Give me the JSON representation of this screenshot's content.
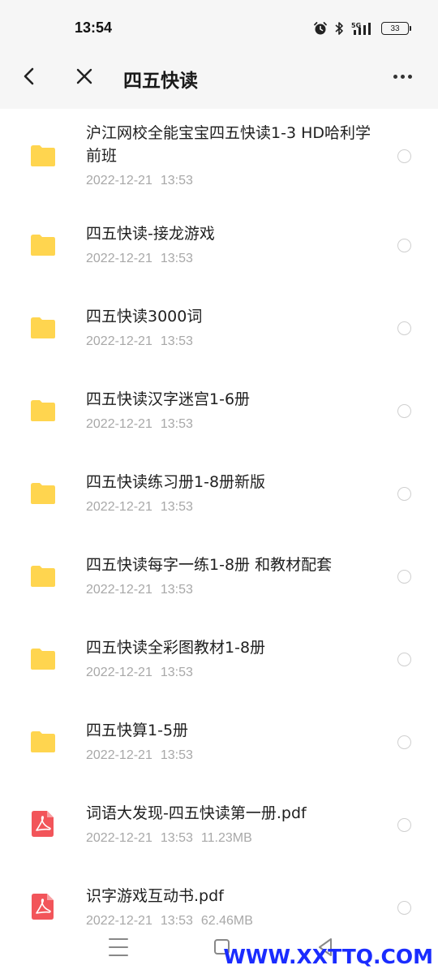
{
  "status_bar": {
    "time": "13:54",
    "icons": [
      "alarm-icon",
      "bluetooth-icon",
      "signal-5g-icon",
      "battery-icon"
    ],
    "network": "5G",
    "battery": "33"
  },
  "header": {
    "title": "四五快读",
    "back_icon": "chevron-left-icon",
    "close_icon": "close-icon",
    "more_icon": "more-icon"
  },
  "files": [
    {
      "name": "沪江网校全能宝宝四五快读1-3 HD哈利学前班",
      "date": "2022-12-21",
      "time": "13:53",
      "size": "",
      "type": "folder"
    },
    {
      "name": "四五快读-接龙游戏",
      "date": "2022-12-21",
      "time": "13:53",
      "size": "",
      "type": "folder"
    },
    {
      "name": "四五快读3000词",
      "date": "2022-12-21",
      "time": "13:53",
      "size": "",
      "type": "folder"
    },
    {
      "name": "四五快读汉字迷宫1-6册",
      "date": "2022-12-21",
      "time": "13:53",
      "size": "",
      "type": "folder"
    },
    {
      "name": "四五快读练习册1-8册新版",
      "date": "2022-12-21",
      "time": "13:53",
      "size": "",
      "type": "folder"
    },
    {
      "name": "四五快读每字一练1-8册 和教材配套",
      "date": "2022-12-21",
      "time": "13:53",
      "size": "",
      "type": "folder"
    },
    {
      "name": "四五快读全彩图教材1-8册",
      "date": "2022-12-21",
      "time": "13:53",
      "size": "",
      "type": "folder"
    },
    {
      "name": "四五快算1-5册",
      "date": "2022-12-21",
      "time": "13:53",
      "size": "",
      "type": "folder"
    },
    {
      "name": "词语大发现-四五快读第一册.pdf",
      "date": "2022-12-21",
      "time": "13:53",
      "size": "11.23MB",
      "type": "pdf"
    },
    {
      "name": "识字游戏互动书.pdf",
      "date": "2022-12-21",
      "time": "13:53",
      "size": "62.46MB",
      "type": "pdf"
    }
  ],
  "colors": {
    "folder": "#FFD54F",
    "pdf": "#F2555A",
    "header_bg": "#F6F6F6",
    "meta_text": "#A8A8A8"
  },
  "nav_bar": {
    "icons": [
      "menu-icon",
      "home-icon",
      "back-icon"
    ]
  },
  "watermark": "WWW.XXTTQ.COM"
}
